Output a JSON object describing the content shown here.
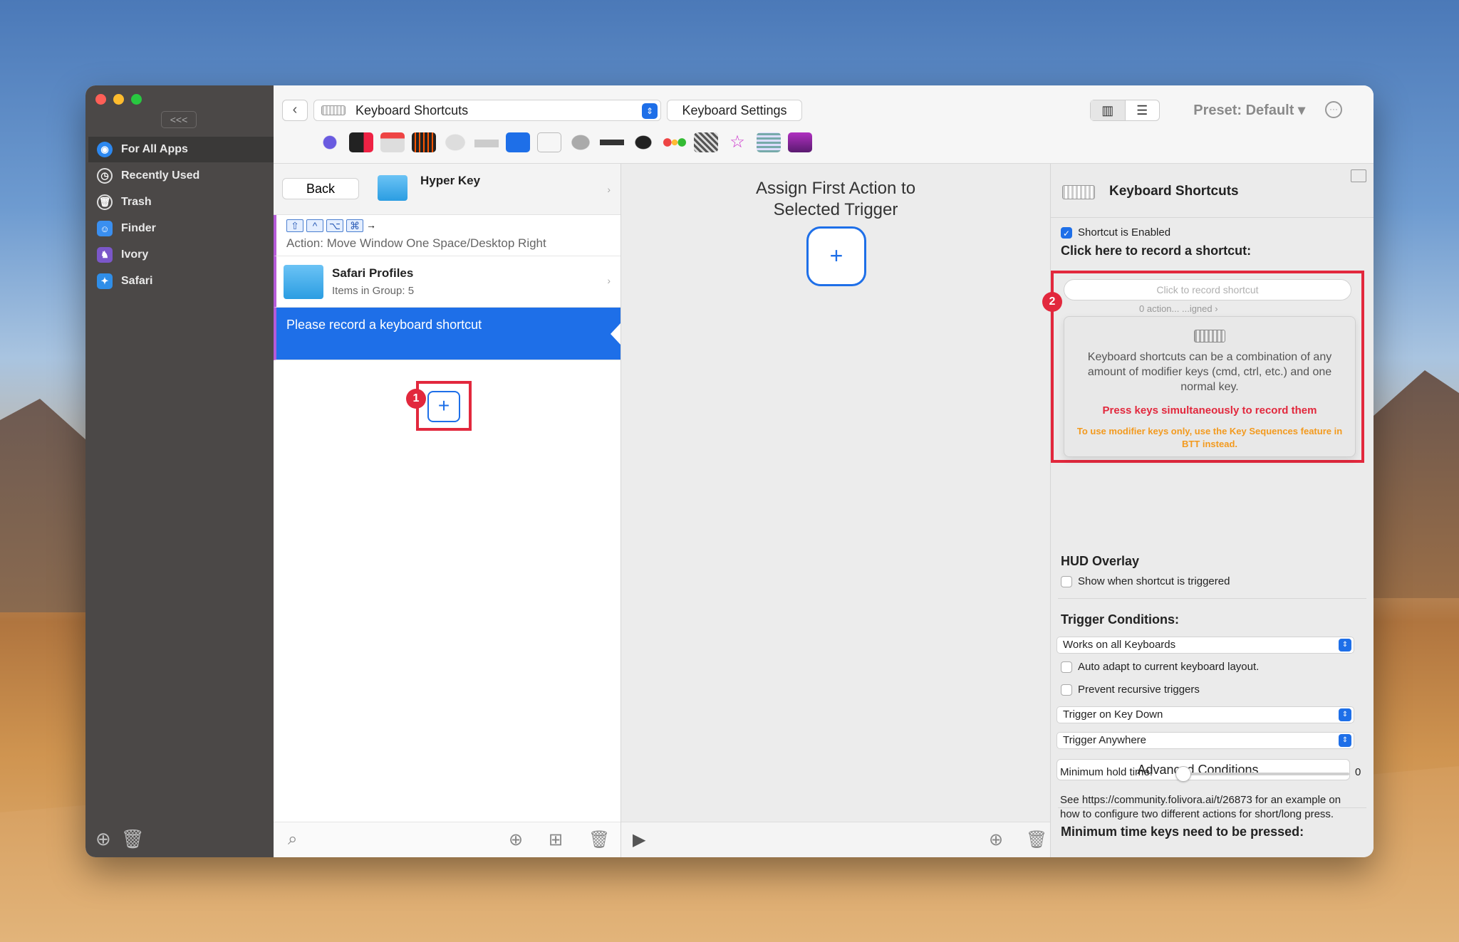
{
  "sidebar": {
    "collapse_label": "<<<",
    "items": [
      {
        "label": "For All Apps",
        "icon": "globe-icon",
        "color": "#2c88f0"
      },
      {
        "label": "Recently Used",
        "icon": "clock-icon",
        "color": "#6d6a69"
      },
      {
        "label": "Trash",
        "icon": "trash-icon",
        "color": "#6d6a69"
      },
      {
        "label": "Finder",
        "icon": "finder-icon",
        "color": "#3a8ff0"
      },
      {
        "label": "Ivory",
        "icon": "ivory-icon",
        "color": "#7b57c9"
      },
      {
        "label": "Safari",
        "icon": "safari-icon",
        "color": "#2f8ee8"
      }
    ]
  },
  "toolbar": {
    "trigger_select": "Keyboard Shortcuts",
    "keyboard_settings": "Keyboard Settings",
    "preset": "Preset: Default",
    "accent": "#1e6fe8"
  },
  "list": {
    "back": "Back",
    "group_title": "Hyper Key",
    "row1_keys": [
      "⇧",
      "^",
      "⌥",
      "⌘"
    ],
    "row1_arrow": "→",
    "row1_action": "Action: Move Window One Space/Desktop Right",
    "row2_title": "Safari Profiles",
    "row2_sub": "Items in Group: 5",
    "row3_text": "Please record a keyboard shortcut",
    "add_symbol": "+",
    "badge1": "1"
  },
  "middle": {
    "title_line1": "Assign First Action to",
    "title_line2": "Selected Trigger",
    "add_symbol": "+"
  },
  "right": {
    "title": "Keyboard Shortcuts",
    "shortcut_enabled": "Shortcut is Enabled",
    "record_heading": "Click here to record a shortcut:",
    "record_placeholder": "Click to record shortcut",
    "record_peek": "0 action... ...igned ›",
    "badge2": "2",
    "pop_text": "Keyboard shortcuts can be a combination of any amount of modifier keys (cmd, ctrl, etc.) and one normal key.",
    "pop_red": "Press keys simultaneously to record them",
    "pop_orange": "To use modifier keys only, use the Key Sequences feature in BTT instead.",
    "hud_heading": "HUD Overlay",
    "hud_checkbox": "Show when shortcut is triggered",
    "trigger_conditions": "Trigger Conditions:",
    "select_keyboards": "Works on all Keyboards",
    "auto_adapt": "Auto adapt to current keyboard layout.",
    "prevent_recursive": "Prevent recursive triggers",
    "select_keydown": "Trigger on Key Down",
    "select_anywhere": "Trigger Anywhere",
    "advanced": "Advanced Conditions...",
    "min_time_heading": "Minimum time keys need to be pressed:",
    "min_hold_label": "Minimum hold time:",
    "min_hold_value": "0",
    "note": "See https://community.folivora.ai/t/26873 for an example on how to configure two different actions for short/long press."
  }
}
